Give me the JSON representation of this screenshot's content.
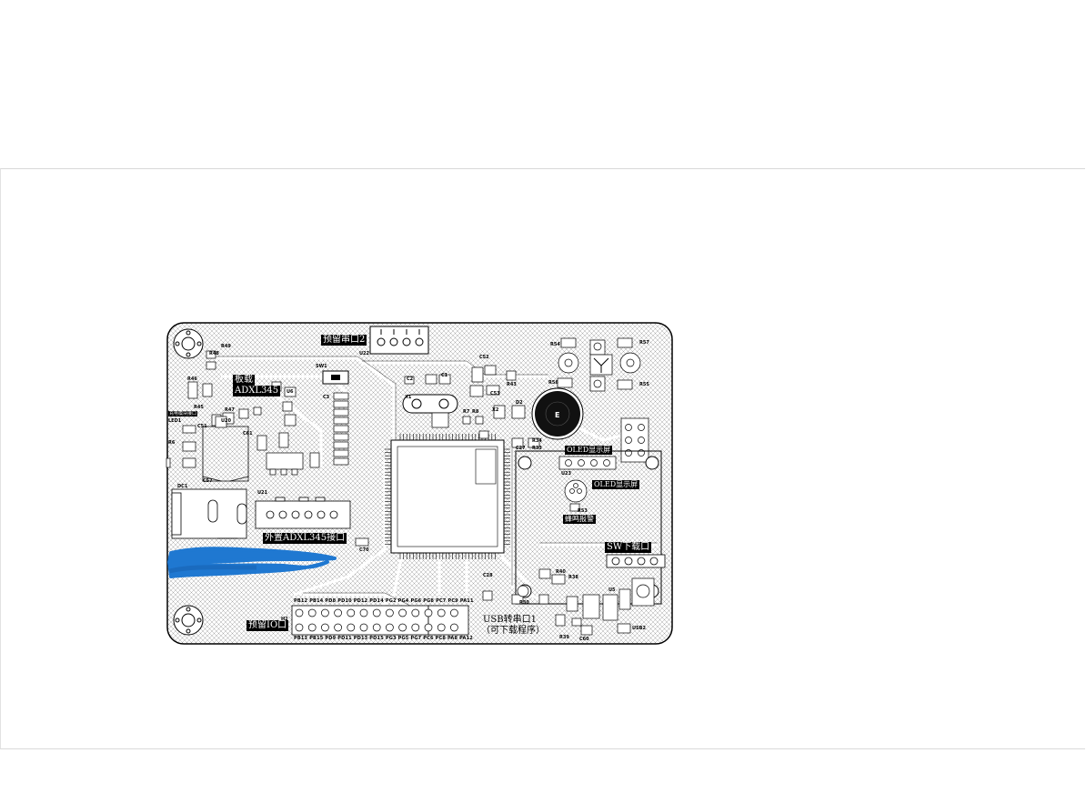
{
  "labels": {
    "uart2": "预留串口2",
    "onboard_line1": "板载",
    "onboard_line2": "ADXL345",
    "ext_adxl": "外置ADXL345接口",
    "oled": "OLED显示屏",
    "oled_slot": "OLED显示屏",
    "beeper": "蜂鸣报警",
    "swd": "SW下载口",
    "reserved_io": "预留IO口",
    "usb_line1": "USB转串口1",
    "usb_line2": "（可下载程序）",
    "charge": "充电模块接口"
  },
  "pins_top": [
    "PB12",
    "PB14",
    "PD8",
    "PD10",
    "PD12",
    "PD14",
    "PG2",
    "PG4",
    "PG6",
    "PG8",
    "PC7",
    "PC9",
    "PA11"
  ],
  "pins_bottom": [
    "PB13",
    "PB15",
    "PD9",
    "PD11",
    "PD13",
    "PD15",
    "PG3",
    "PG5",
    "PG7",
    "PC6",
    "PC8",
    "PA8",
    "PA12"
  ],
  "refs": {
    "r49": "R49",
    "r48": "R48",
    "r46": "R46",
    "u6": "U6",
    "r45": "R45",
    "r44": "R44",
    "u20": "U20",
    "r47": "R47",
    "c61": "C61",
    "led1": "LED1",
    "r6": "R6",
    "c51": "C51",
    "c57": "C57",
    "dc1": "DC1",
    "u21": "U21",
    "u22": "U22",
    "sw1": "SW1",
    "c3": "C3",
    "c1": "C1",
    "c2": "C2",
    "d1": "D1",
    "x1": "X1",
    "c52": "C52",
    "c53": "C53",
    "r43": "R43",
    "d2": "D2",
    "r7": "R7",
    "r8": "R8",
    "x2": "X2",
    "q1": "Q1",
    "c27": "C27",
    "r33": "R33",
    "r34": "R34",
    "u23": "U23",
    "r53": "R53",
    "r54": "R54",
    "r55": "R55",
    "r56": "R56",
    "r57": "R57",
    "r40": "R40",
    "r38": "R38",
    "u5": "U5",
    "usb2": "USB2",
    "c60": "C60",
    "r39": "R39",
    "c28": "C28",
    "r30": "R30",
    "h2": "H2",
    "c70": "C70",
    "e": "E"
  },
  "colors": {
    "board_outline": "#000000",
    "hatch": "#9a9a9a",
    "silkscreen_label_bg": "#000000",
    "redaction": "#1f78d1"
  }
}
